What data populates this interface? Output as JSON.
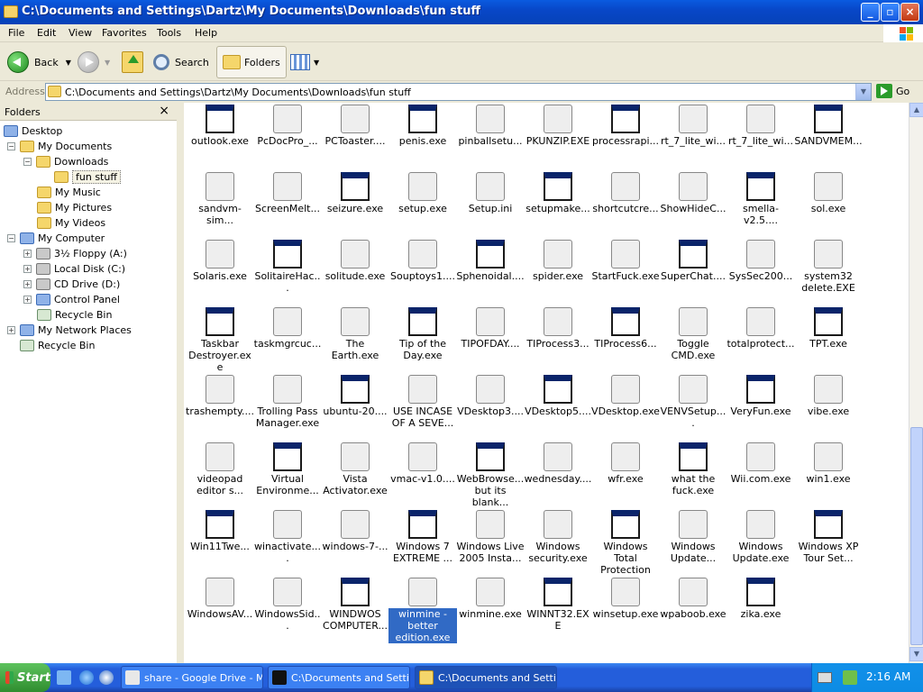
{
  "window": {
    "title": "C:\\Documents and Settings\\Dartz\\My Documents\\Downloads\\fun stuff",
    "min": "_",
    "max": "▫",
    "close": "×"
  },
  "menu": [
    "File",
    "Edit",
    "View",
    "Favorites",
    "Tools",
    "Help"
  ],
  "toolbar": {
    "back": "Back",
    "search": "Search",
    "folders": "Folders"
  },
  "address": {
    "label": "Address",
    "value": "C:\\Documents and Settings\\Dartz\\My Documents\\Downloads\\fun stuff",
    "go": "Go"
  },
  "folders_pane": {
    "title": "Folders",
    "close": "×",
    "tree": [
      "Desktop",
      "My Documents",
      "Downloads",
      "fun stuff",
      "My Music",
      "My Pictures",
      "My Videos",
      "My Computer",
      "3½ Floppy (A:)",
      "Local Disk (C:)",
      "CD Drive (D:)",
      "Control Panel",
      "Recycle Bin",
      "My Network Places",
      "Recycle Bin"
    ]
  },
  "files": [
    [
      "outlook.exe",
      "PcDocPro_...",
      "PCToaster....",
      "penis.exe",
      "pinballsetu...",
      "PKUNZIP.EXE",
      "processrapi...",
      "rt_7_lite_wi...",
      "rt_7_lite_wi...",
      "SANDVMEM..."
    ],
    [
      "sandvm-sim...",
      "ScreenMelt...",
      "seizure.exe",
      "setup.exe",
      "Setup.ini",
      "setupmake...",
      "shortcutcre...",
      "ShowHideC...",
      "smella-v2.5....",
      "sol.exe"
    ],
    [
      "Solaris.exe",
      "SolitaireHac...",
      "solitude.exe",
      "Souptoys1....",
      "Sphenoidal....",
      "spider.exe",
      "StartFuck.exe",
      "SuperChat....",
      "SysSec200...",
      "system32 delete.EXE"
    ],
    [
      "Taskbar Destroyer.exe",
      "taskmgrcuc...",
      "The Earth.exe",
      "Tip of the Day.exe",
      "TIPOFDAY....",
      "TIProcess3...",
      "TIProcess6...",
      "Toggle CMD.exe",
      "totalprotect...",
      "TPT.exe"
    ],
    [
      "trashempty....",
      "Trolling Pass Manager.exe",
      "ubuntu-20....",
      "USE INCASE OF A SEVE...",
      "VDesktop3....",
      "VDesktop5....",
      "VDesktop.exe",
      "VENVSetup....",
      "VeryFun.exe",
      "vibe.exe"
    ],
    [
      "videopad editor s...",
      "Virtual Environme...",
      "Vista Activator.exe",
      "vmac-v1.0....",
      "WebBrowse... but its blank...",
      "wednesday....",
      "wfr.exe",
      "what the fuck.exe",
      "Wii.com.exe",
      "win1.exe"
    ],
    [
      "Win11Twe...",
      "winactivate....",
      "windows-7-...",
      "Windows 7 EXTREME ...",
      "Windows Live 2005 Insta...",
      "Windows security.exe",
      "Windows Total Protection 2...",
      "Windows Update...",
      "Windows Update.exe",
      "Windows XP Tour Set..."
    ],
    [
      "WindowsAV...",
      "WindowsSid...",
      "WINDWOS COMPUTER...",
      "winmine - better edition.exe",
      "winmine.exe",
      "WINNT32.EXE",
      "winsetup.exe",
      "wpaboob.exe",
      "zika.exe"
    ]
  ],
  "selected_file": "winmine - better edition.exe",
  "taskbar": {
    "start": "Start",
    "tasks": [
      "share - Google Drive - M...",
      "C:\\Documents and Setti...",
      "C:\\Documents and Setti..."
    ],
    "clock": "2:16 AM"
  },
  "colors": {
    "titlebar": "#0a5be0",
    "taskbar": "#245edb",
    "selection": "#316ac5",
    "start": "#3c9c3c"
  }
}
